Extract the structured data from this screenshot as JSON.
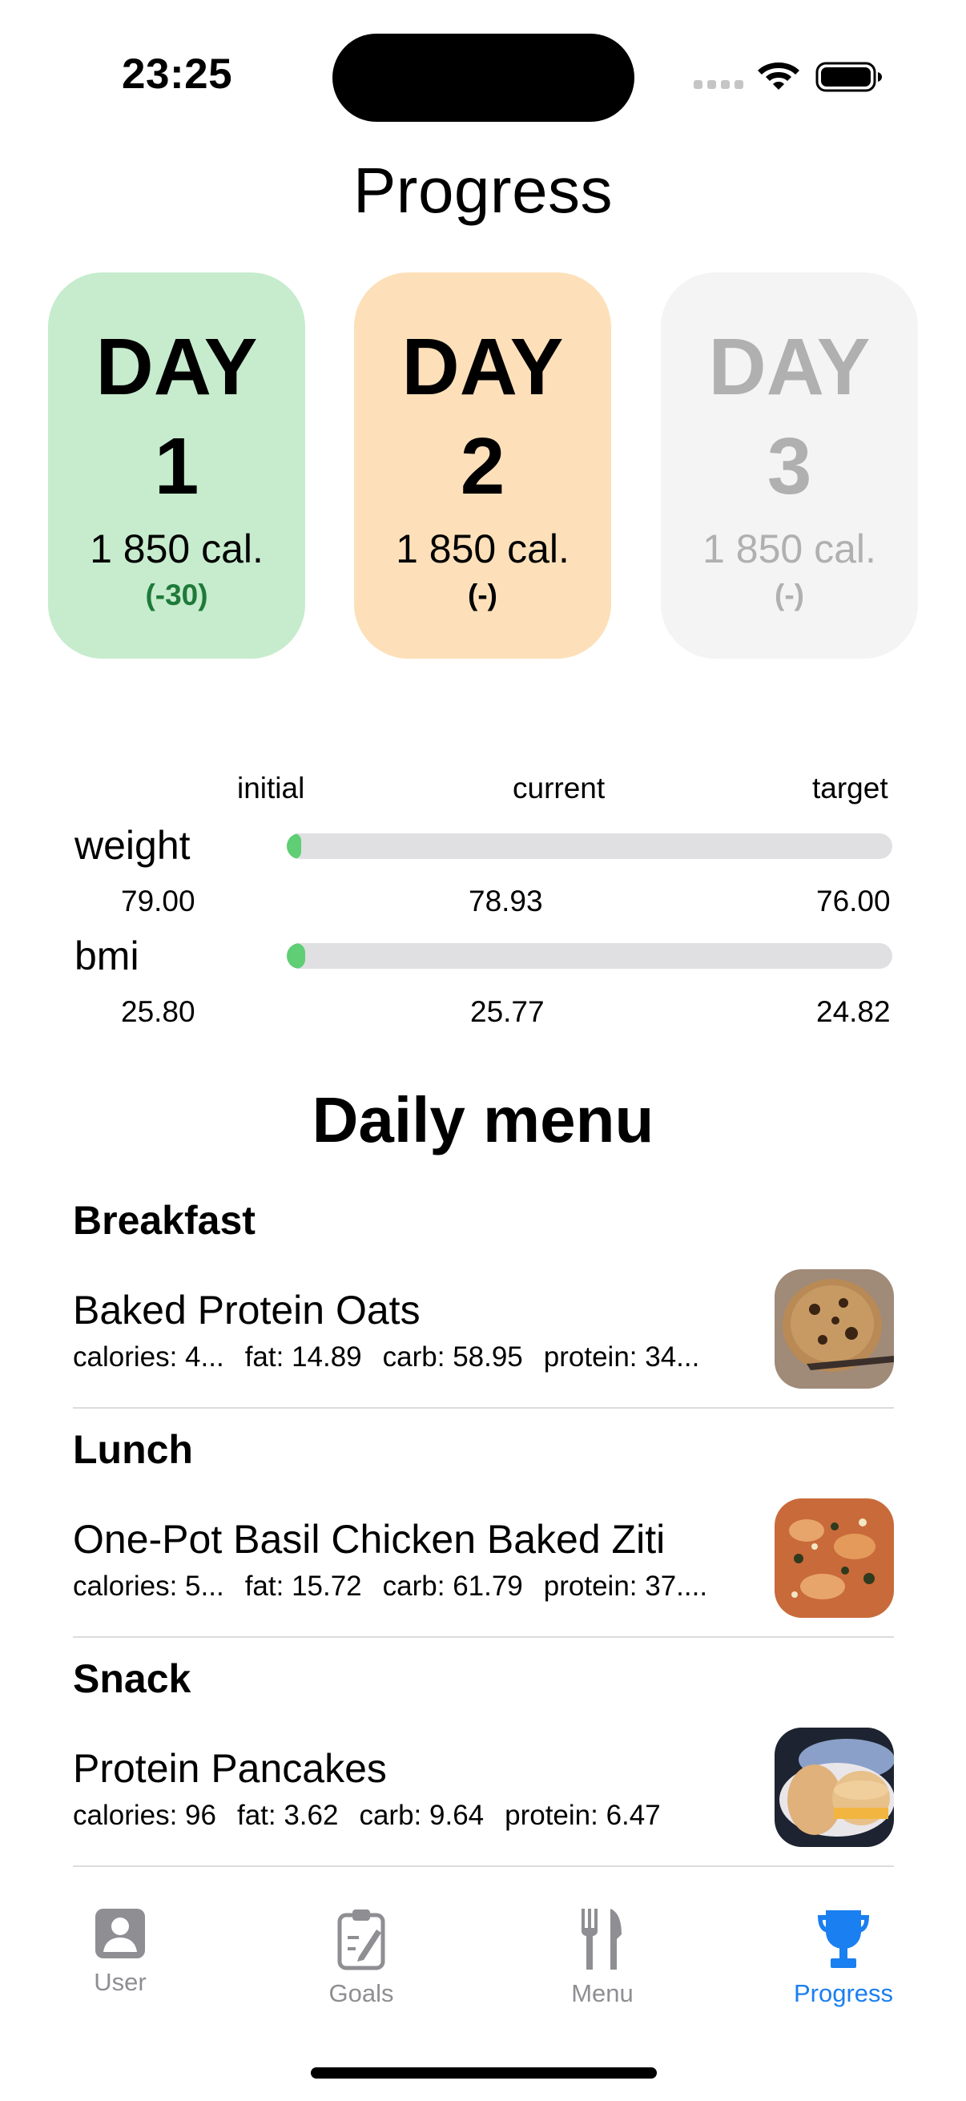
{
  "status_bar": {
    "time": "23:25"
  },
  "page": {
    "title": "Progress"
  },
  "days": [
    {
      "word": "DAY",
      "number": "1",
      "calories": "1 850 cal.",
      "diff": "(-30)",
      "state": "done",
      "color": "#c6eccd",
      "diff_color": "#1e7a3a"
    },
    {
      "word": "DAY",
      "number": "2",
      "calories": "1 850 cal.",
      "diff": "(-)",
      "state": "current",
      "color": "#fde0b9",
      "diff_color": "#000000"
    },
    {
      "word": "DAY",
      "number": "3",
      "calories": "1 850 cal.",
      "diff": "(-)",
      "state": "upcoming",
      "color": "#f4f4f4",
      "diff_color": "#b0b0b0"
    }
  ],
  "stats": {
    "headers": {
      "initial": "initial",
      "current": "current",
      "target": "target"
    },
    "weight": {
      "label": "weight",
      "initial": "79.00",
      "current": "78.93",
      "target": "76.00",
      "progress": 0.023
    },
    "bmi": {
      "label": "bmi",
      "initial": "25.80",
      "current": "25.77",
      "target": "24.82",
      "progress": 0.03
    },
    "accent_color": "#5fce74"
  },
  "menu": {
    "title": "Daily menu",
    "meals": [
      {
        "type": "Breakfast",
        "name": "Baked Protein Oats",
        "calories": "calories: 4...",
        "fat": "fat: 14.89",
        "carb": "carb: 58.95",
        "protein": "protein: 34...",
        "image_icon": "baked-oats-photo"
      },
      {
        "type": "Lunch",
        "name": "One-Pot Basil Chicken Baked Ziti",
        "calories": "calories: 5...",
        "fat": "fat: 15.72",
        "carb": "carb: 61.79",
        "protein": "protein: 37....",
        "image_icon": "baked-ziti-photo"
      },
      {
        "type": "Snack",
        "name": "Protein Pancakes",
        "calories": "calories: 96",
        "fat": "fat: 3.62",
        "carb": "carb: 9.64",
        "protein": "protein: 6.47",
        "image_icon": "pancakes-photo"
      }
    ]
  },
  "tabbar": {
    "items": [
      {
        "label": "User",
        "icon": "user-icon",
        "active": false
      },
      {
        "label": "Goals",
        "icon": "clipboard-icon",
        "active": false
      },
      {
        "label": "Menu",
        "icon": "fork-knife-icon",
        "active": false
      },
      {
        "label": "Progress",
        "icon": "trophy-icon",
        "active": true
      }
    ],
    "active_color": "#1a7ff0",
    "inactive_color": "#8e8e93"
  }
}
